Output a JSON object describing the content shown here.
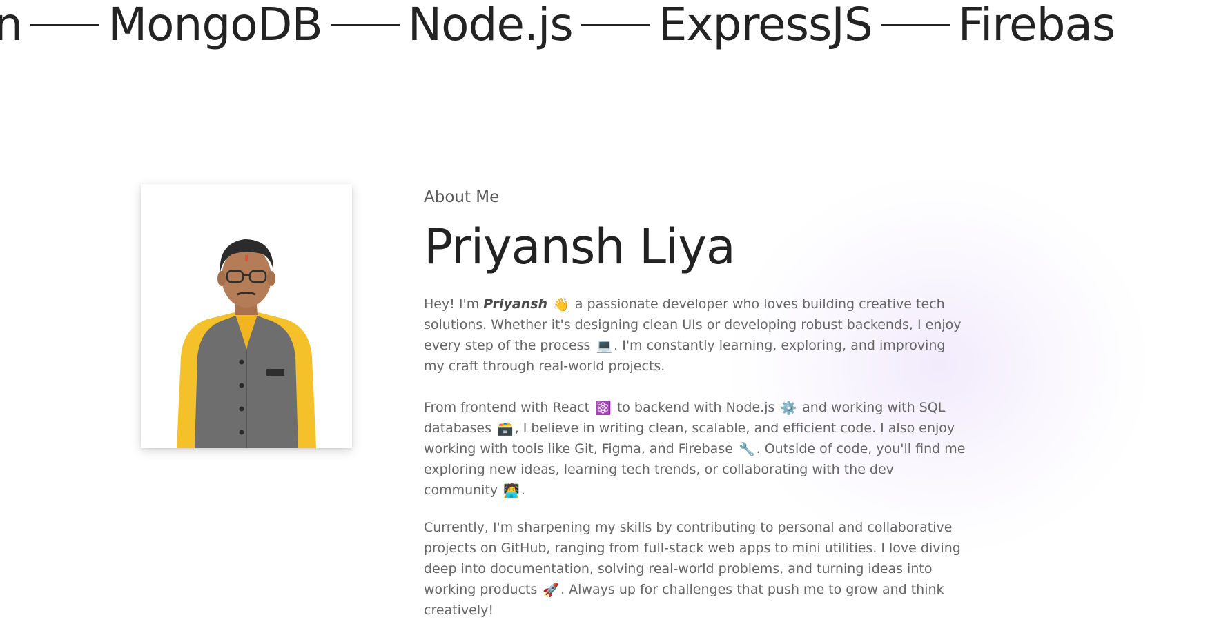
{
  "marquee": {
    "items": [
      "on",
      "MongoDB",
      "Node.js",
      "ExpressJS",
      "Firebas"
    ]
  },
  "photo": {
    "subject": "profile photo of person in yellow shirt and grey vest",
    "colors": {
      "shirt": "#f5c12a",
      "vest": "#6c6c6c",
      "skin": "#b07a55",
      "hair": "#2b2b2b"
    }
  },
  "about": {
    "eyebrow": "About Me",
    "name": "Priyansh Liya",
    "p1": {
      "prefix": "Hey! I'm ",
      "highlight": "Priyansh",
      "emoji_wave": "👋",
      "text_a": " a passionate developer who loves building creative tech solutions. Whether it's designing clean UIs or developing robust backends, I enjoy every step of the process ",
      "emoji_laptop": "💻",
      "text_b": ". I'm constantly learning, exploring, and improving my craft through real-world projects."
    },
    "p2": {
      "text_a": "From frontend with React ",
      "emoji_react": "⚛️",
      "text_b": " to backend with Node.js ",
      "emoji_gear": "⚙️",
      "text_c": " and working with SQL databases ",
      "emoji_db": "🗃️",
      "text_d": ", I believe in writing clean, scalable, and efficient code. I also enjoy working with tools like Git, Figma, and Firebase ",
      "emoji_tool": "🔧",
      "text_e": ". Outside of code, you'll find me exploring new ideas, learning tech trends, or collaborating with the dev community ",
      "emoji_person": "🧑‍💻",
      "text_f": "."
    },
    "p3": {
      "text_a": "Currently, I'm sharpening my skills by contributing to personal and collaborative projects on GitHub, ranging from full-stack web apps to mini utilities. I love diving deep into documentation, solving real-world problems, and turning ideas into working products ",
      "emoji_rocket": "🚀",
      "text_b": ". Always up for challenges that push me to grow and think creatively!"
    }
  },
  "theme": {
    "heading_color": "#222222",
    "body_color": "#666666",
    "glow_color": "#d8c4f6"
  }
}
